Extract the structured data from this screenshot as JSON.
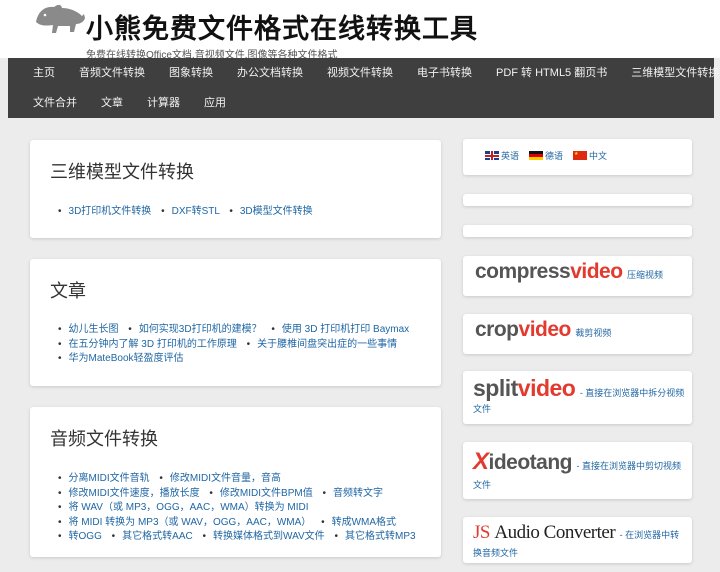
{
  "header": {
    "title": "小熊免费文件格式在线转换工具",
    "description": "免费在线转换Office文档,音视频文件,图像等各种文件格式"
  },
  "nav": {
    "row1": [
      "主页",
      "音频文件转换",
      "图象转换",
      "办公文档转换",
      "视频文件转换",
      "电子书转换",
      "PDF 转 HTML5 翻页书",
      "三维模型文件转换"
    ],
    "row2": [
      "文件合并",
      "文章",
      "计算器",
      "应用"
    ]
  },
  "sections": [
    {
      "title": "三维模型文件转换",
      "lines": [
        [
          "3D打印机文件转换",
          "DXF转STL",
          "3D模型文件转换"
        ]
      ]
    },
    {
      "title": "文章",
      "lines": [
        [
          "幼儿生长图",
          "如何实现3D打印机的建模？",
          "使用 3D 打印机打印 Baymax"
        ],
        [
          "在五分钟内了解 3D 打印机的工作原理",
          "关于腰椎间盘突出症的一些事情"
        ],
        [
          "华为MateBook轻盈度评估"
        ]
      ]
    },
    {
      "title": "音频文件转换",
      "lines": [
        [
          "分离MIDI文件音轨",
          "修改MIDI文件音量，音高"
        ],
        [
          "修改MIDI文件速度，播放长度",
          "修改MIDI文件BPM值",
          "音频转文字"
        ],
        [
          "将 WAV（或 MP3，OGG，AAC，WMA）转换为 MIDI"
        ],
        [
          "将 MIDI 转换为 MP3（或 WAV，OGG，AAC，WMA）",
          "转成WMA格式"
        ],
        [
          "转OGG",
          "其它格式转AAC",
          "转换媒体格式到WAV文件",
          "其它格式转MP3"
        ]
      ]
    }
  ],
  "sidebar": {
    "languages": [
      "英语",
      "德语",
      "中文"
    ],
    "apps": [
      {
        "grey": "compress",
        "red": "video",
        "note": "压缩视频"
      },
      {
        "grey": "crop",
        "red": "video",
        "note": "裁剪视频"
      },
      {
        "grey": "split",
        "red": "video",
        "note": "- 直接在浏览器中拆分视频文件"
      },
      {
        "red": "X",
        "grey": "ideotang",
        "note": "- 直接在浏览器中剪切视频文件"
      },
      {
        "red": "JS",
        "grey": "Audio Converter",
        "note": "- 在浏览器中转换音频文件"
      }
    ]
  }
}
